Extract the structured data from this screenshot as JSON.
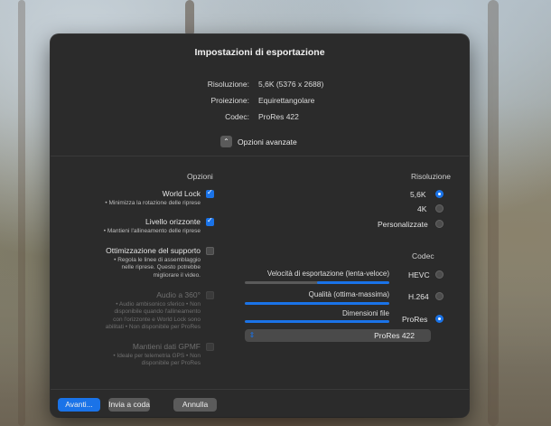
{
  "dialog": {
    "title": "Impostazioni di esportazione",
    "info": [
      {
        "label": "Risoluzione:",
        "value": "5,6K (5376 x 2688)"
      },
      {
        "label": "Proiezione:",
        "value": "Equirettangolare"
      },
      {
        "label": "Codec:",
        "value": "ProRes 422"
      }
    ],
    "advanced_label": "Opzioni avanzate",
    "advanced_icon": "chevron-up-icon",
    "resolution": {
      "heading": "Risoluzione",
      "options": [
        "5,6K",
        "4K",
        "Personalizzate"
      ],
      "selected": "5,6K"
    },
    "codec": {
      "heading": "Codec",
      "options": [
        "HEVC",
        "H.264",
        "ProRes"
      ],
      "selected": "ProRes",
      "sliders": [
        {
          "label": "Velocità di esportazione (lenta-veloce)",
          "value": 0.5
        },
        {
          "label": "Qualità (ottima-massima)",
          "value": 1.0
        },
        {
          "label": "Dimensioni file",
          "value": 1.0
        }
      ],
      "dropdown_value": "ProRes 422"
    },
    "options": {
      "heading": "Opzioni",
      "items": [
        {
          "title": "World Lock",
          "desc": "• Minimizza la rotazione delle riprese",
          "checked": true,
          "enabled": true
        },
        {
          "title": "Livello orizzonte",
          "desc": "• Mantieni l'allineamento delle riprese",
          "checked": true,
          "enabled": true
        },
        {
          "title": "Ottimizzazione del supporto",
          "desc": "• Regola le linee di assemblaggio nelle riprese. Questo potrebbe migliorare il video.",
          "checked": false,
          "enabled": true
        },
        {
          "title": "Audio a 360°",
          "desc": "• Audio ambisonico sferico • Non disponibile quando l'allineamento con l'orizzonte e World Lock sono abilitati • Non disponibile per ProRes",
          "checked": false,
          "enabled": false
        },
        {
          "title": "Mantieni dati GPMF",
          "desc": "• Ideale per telemetria GPS • Non disponibile per ProRes",
          "checked": false,
          "enabled": false
        }
      ]
    },
    "buttons": {
      "next": "Avanti...",
      "queue": "Invia a coda",
      "cancel": "Annulla"
    }
  }
}
